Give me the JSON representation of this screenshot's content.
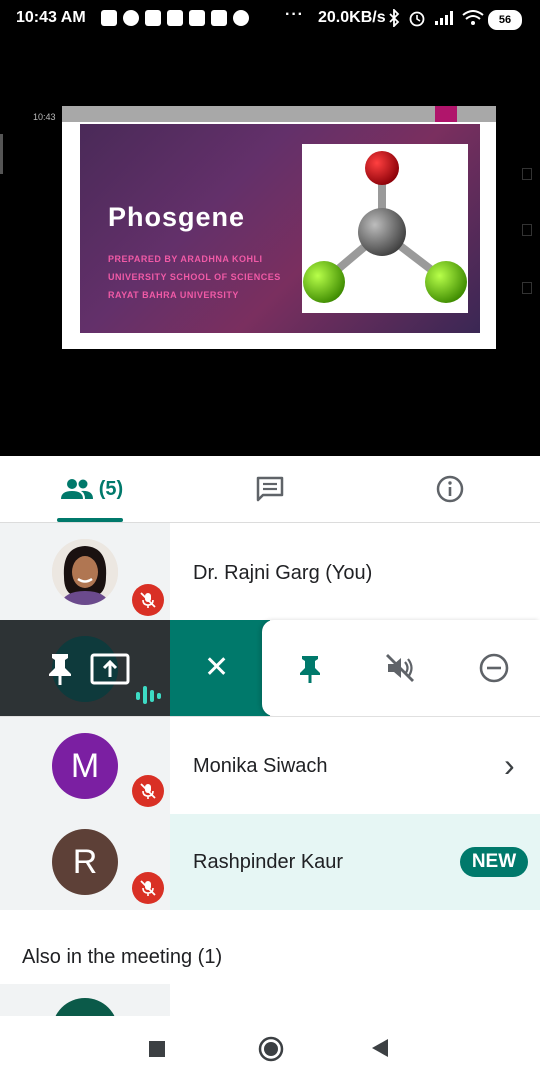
{
  "status_bar": {
    "time": "10:43 AM",
    "dots": "···",
    "net_speed": "20.0KB/s",
    "battery": "56"
  },
  "presentation": {
    "mini_time": "10:43",
    "title": "Phosgene",
    "lines": [
      "PREPARED BY ARADHNA KOHLI",
      "UNIVERSITY SCHOOL OF SCIENCES",
      "RAYAT BAHRA UNIVERSITY"
    ]
  },
  "tabs": {
    "people_count": "(5)",
    "people_icon": "people-icon",
    "chat_icon": "chat-icon",
    "info_icon": "info-icon"
  },
  "participants": [
    {
      "name": "Dr. Rajni Garg (You)",
      "avatar": "photo",
      "muted": true
    },
    {
      "name": "Monika Siwach",
      "initial": "M",
      "color": "#7b1fa2",
      "muted": true,
      "chevron": "›"
    },
    {
      "name": "Rashpinder Kaur",
      "initial": "R",
      "color": "#5d4037",
      "muted": true,
      "badge": "NEW"
    }
  ],
  "actions": {
    "close": "✕",
    "icons": [
      "pin-icon",
      "mute-speaker-icon",
      "remove-icon"
    ]
  },
  "also_in_meeting": "Also in the meeting (1)",
  "colors": {
    "accent": "#00796b",
    "mute_red": "#d93025",
    "slide_bg": "#63306a",
    "slide_sub": "#f05aa6"
  }
}
